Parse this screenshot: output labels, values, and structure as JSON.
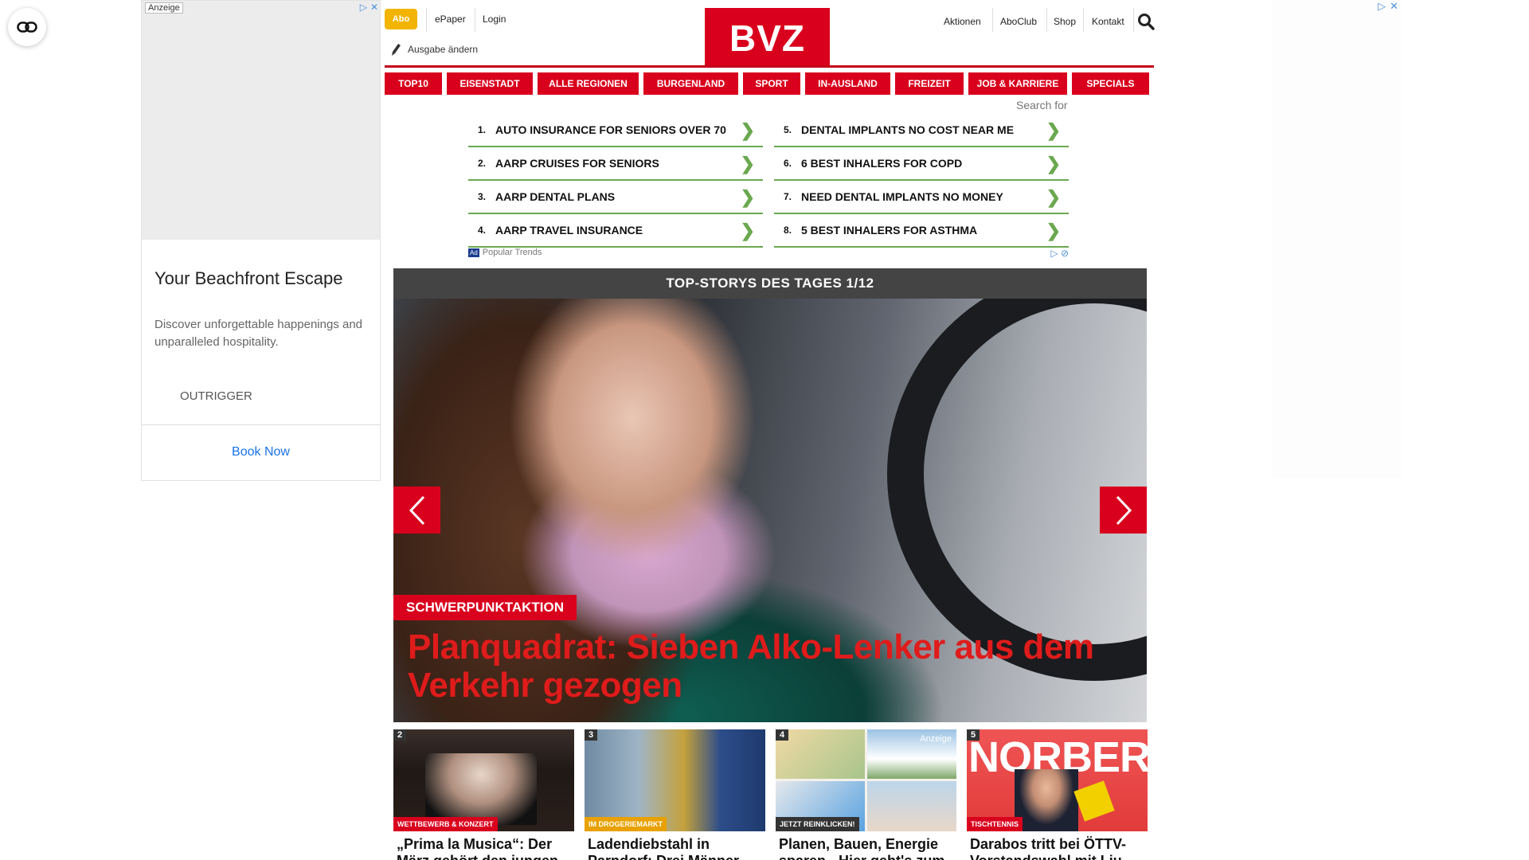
{
  "left_ad": {
    "label": "Anzeige",
    "title": "Your Beachfront Escape",
    "description": "Discover unforgettable happenings and unparalleled hospitality.",
    "brand": "OUTRIGGER",
    "cta": "Book Now"
  },
  "header": {
    "abo": "Abo",
    "epaper": "ePaper",
    "login": "Login",
    "ausgabe": "Ausgabe ändern",
    "logo": "BVZ",
    "links": [
      "Aktionen",
      "AboClub",
      "Shop",
      "Kontakt"
    ]
  },
  "nav": {
    "items": [
      "TOP10",
      "EISENSTADT",
      "ALLE REGIONEN",
      "BURGENLAND",
      "SPORT",
      "IN-AUSLAND",
      "FREIZEIT",
      "JOB & KARRIERE",
      "SPECIALS"
    ]
  },
  "search_ads": {
    "heading": "Search for",
    "left": [
      {
        "num": "1.",
        "label": "AUTO INSURANCE FOR SENIORS OVER 70"
      },
      {
        "num": "2.",
        "label": "AARP CRUISES FOR SENIORS"
      },
      {
        "num": "3.",
        "label": "AARP DENTAL PLANS"
      },
      {
        "num": "4.",
        "label": "AARP TRAVEL INSURANCE"
      }
    ],
    "right": [
      {
        "num": "5.",
        "label": "DENTAL IMPLANTS NO COST NEAR ME"
      },
      {
        "num": "6.",
        "label": "6 BEST INHALERS FOR COPD"
      },
      {
        "num": "7.",
        "label": "NEED DENTAL IMPLANTS NO MONEY"
      },
      {
        "num": "8.",
        "label": "5 BEST INHALERS FOR ASTHMA"
      }
    ],
    "badge": "Ad",
    "footer": "Popular Trends"
  },
  "top_stories": {
    "heading": "TOP-STORYS DES TAGES 1/12",
    "hero": {
      "tag": "SCHWERPUNKTAKTION",
      "title": "Planquadrat: Sieben Alko-Lenker aus dem Verkehr gezogen"
    },
    "cards": [
      {
        "num": "2",
        "tag": "WETTBEWERB & KONZERT",
        "tag_color": "#d9001d",
        "title": "„Prima la Musica“: Der März gehört den jungen"
      },
      {
        "num": "3",
        "tag": "IM DROGERIEMARKT",
        "tag_color": "#e8a100",
        "title": "Ladendiebstahl in Parndorf: Drei Männer"
      },
      {
        "num": "4",
        "tag": "JETZT REINKLICKEN!",
        "tag_color": "#333333",
        "title": "Planen, Bauen, Energie sparen - Hier geht's zum",
        "anzeige": "Anzeige"
      },
      {
        "num": "5",
        "tag": "TISCHTENNIS",
        "tag_color": "#d9001d",
        "title": "Darabos tritt bei ÖTTV-Vorstandswahl mit Liu",
        "overlay": "NORBERT"
      }
    ]
  },
  "colors": {
    "brand_red": "#d9001d",
    "abo_yellow": "#f2b400",
    "search_green": "#6aa84f"
  }
}
